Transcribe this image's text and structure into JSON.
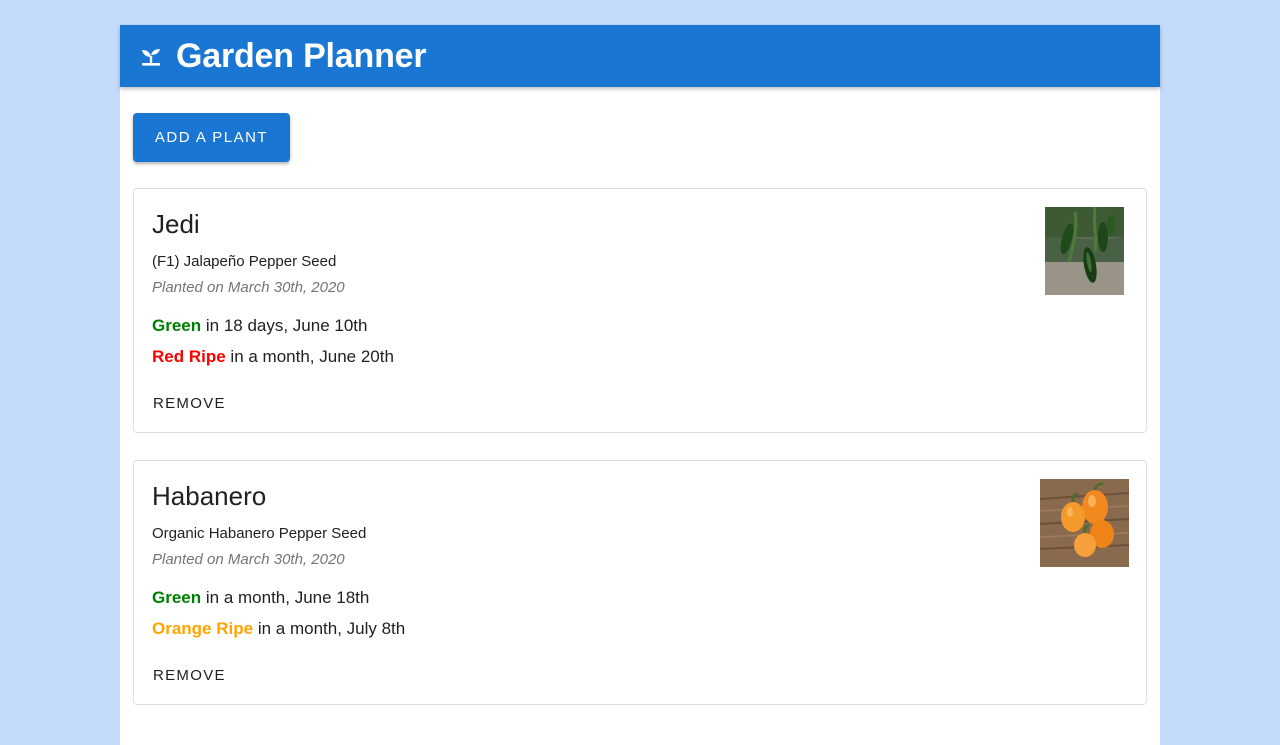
{
  "app": {
    "title": "Garden Planner",
    "icon": "sprout-icon",
    "brand_color": "#1976d2"
  },
  "actions": {
    "add_label": "ADD A PLANT"
  },
  "plants": [
    {
      "name": "Jedi",
      "variety": "(F1) Jalapeño Pepper Seed",
      "planted": "Planted on March 30th, 2020",
      "stages": [
        {
          "label": "Green",
          "when": " in 18 days, June 10th",
          "color": "#008000"
        },
        {
          "label": "Red Ripe",
          "when": " in a month, June 20th",
          "color": "#ff0000"
        }
      ],
      "image": "jalapeno-photo",
      "remove_label": "REMOVE"
    },
    {
      "name": "Habanero",
      "variety": "Organic Habanero Pepper Seed",
      "planted": "Planted on March 30th, 2020",
      "stages": [
        {
          "label": "Green",
          "when": " in a month, June 18th",
          "color": "#008000"
        },
        {
          "label": "Orange Ripe",
          "when": " in a month, July 8th",
          "color": "#ffa500"
        }
      ],
      "image": "habanero-photo",
      "remove_label": "REMOVE"
    }
  ]
}
